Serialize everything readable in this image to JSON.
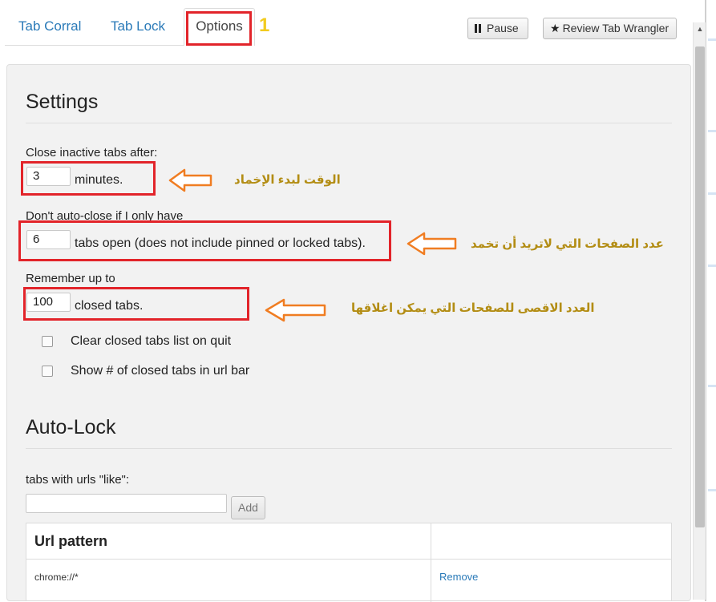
{
  "tabs": [
    {
      "label": "Tab Corral"
    },
    {
      "label": "Tab Lock"
    },
    {
      "label": "Options"
    }
  ],
  "annotation_number": "1",
  "header_buttons": {
    "pause": "Pause",
    "review": "Review Tab Wrangler"
  },
  "settings": {
    "heading": "Settings",
    "close_after_label": "Close inactive tabs after:",
    "close_after_value": "3",
    "close_after_unit": "minutes.",
    "min_tabs_label": "Don't auto-close if I only have",
    "min_tabs_value": "6",
    "min_tabs_unit": "tabs open (does not include pinned or locked tabs).",
    "remember_label": "Remember up to",
    "remember_value": "100",
    "remember_unit": "closed tabs.",
    "checkboxes": [
      {
        "label": "Clear closed tabs list on quit",
        "checked": false
      },
      {
        "label": "Show # of closed tabs in url bar",
        "checked": false
      }
    ]
  },
  "annotations_ar": {
    "note1": "الوقت لبدء الإخماد",
    "note2": "عدد الصفحات التي لاتريد أن تخمد",
    "note3": "العدد الاقصى للصفحات التي يمكن اغلاقها"
  },
  "autolock": {
    "heading": "Auto-Lock",
    "urls_label": "tabs with urls \"like\":",
    "input_value": "",
    "add_label": "Add",
    "table_header": "Url pattern",
    "rows": [
      {
        "pattern": "chrome://*",
        "action": "Remove"
      }
    ]
  },
  "colors": {
    "highlight_red": "#e2242a",
    "arrow_orange": "#f07d22",
    "note_gold": "#b38d14",
    "link_blue": "#2a7ab8",
    "number_yellow": "#f2cb1f"
  }
}
